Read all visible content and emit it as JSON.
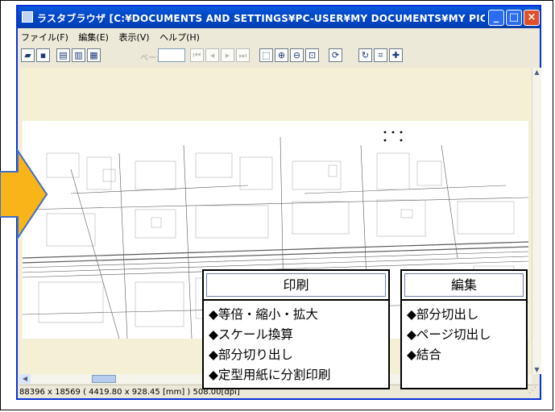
{
  "window": {
    "title": "ラスタブラウザ [C:¥DOCUMENTS AND SETTINGS¥PC-USER¥MY DOCUMENTS¥MY PICTURES...",
    "buttons": {
      "minimize": "_",
      "maximize": "□",
      "close": "×"
    }
  },
  "menu": [
    "ファイル(F)",
    "編集(E)",
    "表示(V)",
    "ヘルプ(H)"
  ],
  "toolbar": {
    "page_label": "ページ",
    "page_value": "",
    "icons": [
      "open-icon",
      "save-icon",
      "print-icon",
      "print-preview-icon",
      "page-setup-icon",
      "first-page-icon",
      "prev-page-icon",
      "next-page-icon",
      "last-page-icon",
      "select-area-icon",
      "zoom-in-icon",
      "zoom-out-icon",
      "zoom-fit-icon",
      "rotate-page-icon",
      "refresh-icon",
      "crop-icon",
      "add-icon"
    ]
  },
  "status": {
    "text": "88396 x 18569 ( 4419.80 x 928.45 [mm] ) 508.00[dpi]"
  },
  "callouts": {
    "print": {
      "title": "印刷",
      "items": [
        "◆等倍・縮小・拡大",
        "◆スケール換算",
        "◆部分切り出し",
        "◆定型用紙に分割印刷"
      ]
    },
    "edit": {
      "title": "編集",
      "items": [
        "◆部分切出し",
        "◆ページ切出し",
        "◆結合"
      ]
    }
  },
  "colors": {
    "titlebar": "#0348c8",
    "arrow_fill": "#f8b418",
    "arrow_stroke": "#3d6fc8",
    "viewer_bg": "#f3f0d6"
  }
}
